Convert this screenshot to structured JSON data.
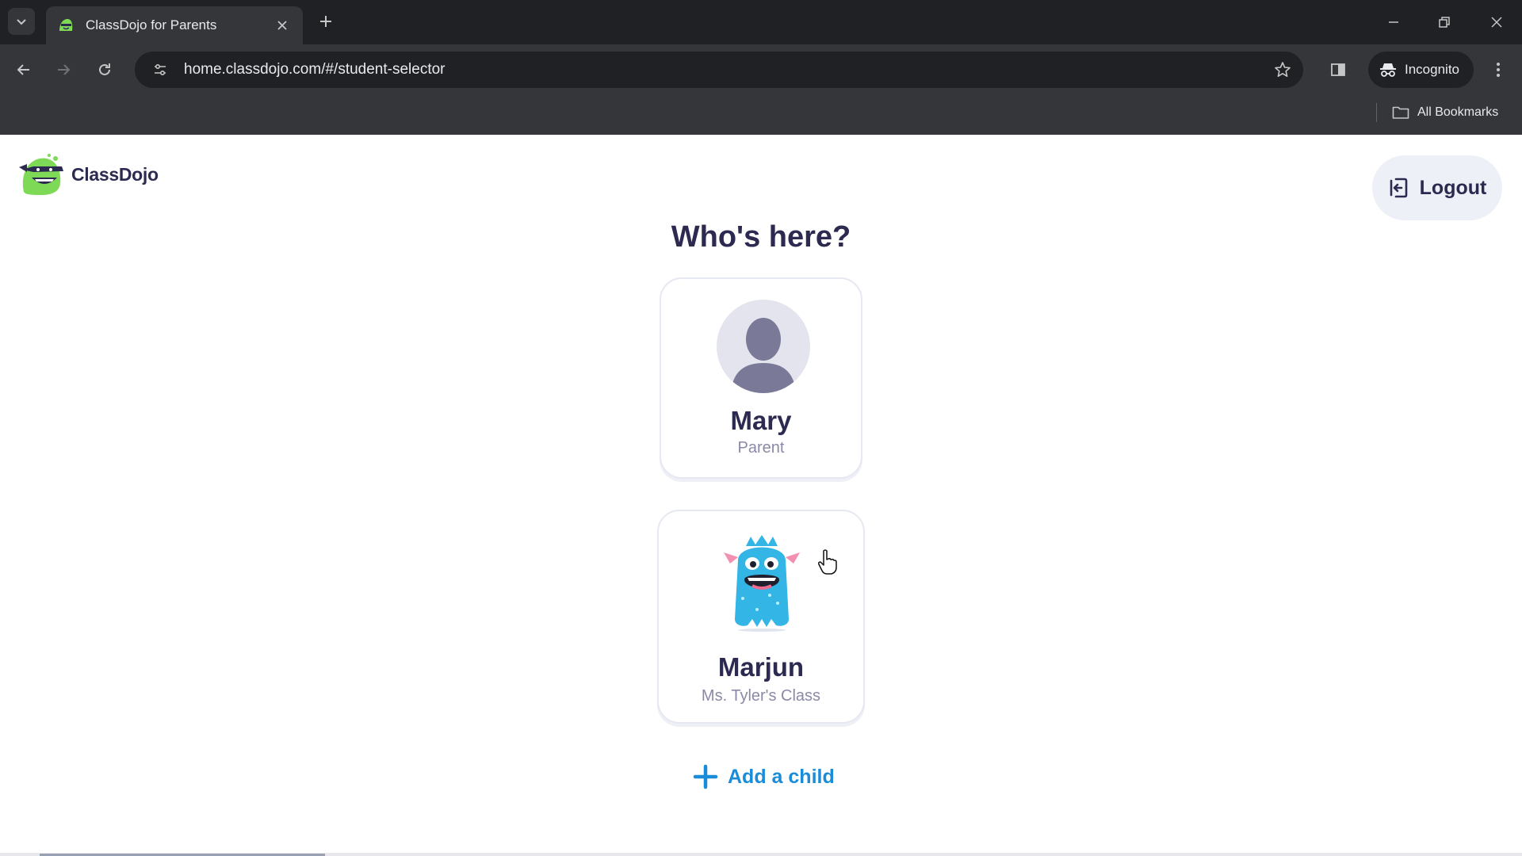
{
  "browser": {
    "tab_title": "ClassDojo for Parents",
    "url": "home.classdojo.com/#/student-selector",
    "incognito_label": "Incognito",
    "bookmarks_label": "All Bookmarks"
  },
  "page": {
    "logo_text": "ClassDojo",
    "logout_label": "Logout",
    "heading": "Who's here?",
    "profiles": [
      {
        "name": "Mary",
        "role": "Parent"
      },
      {
        "name": "Marjun",
        "role": "Ms. Tyler's Class"
      }
    ],
    "add_child_label": "Add a child"
  },
  "colors": {
    "brand_text": "#2c2a50",
    "link_blue": "#1a8cd8",
    "monster_blue": "#33b5e5",
    "logo_green": "#7ed957"
  }
}
